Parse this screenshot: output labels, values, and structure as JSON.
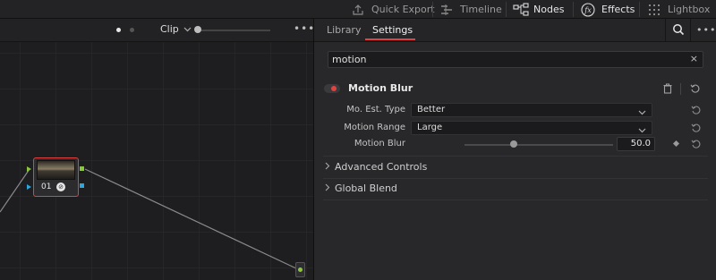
{
  "toolbar": {
    "items": [
      {
        "label": "Quick Export",
        "icon": "upload-icon"
      },
      {
        "label": "Timeline",
        "icon": "timeline-icon"
      },
      {
        "label": "Nodes",
        "icon": "nodes-icon"
      },
      {
        "label": "Effects",
        "icon": "fx-icon"
      },
      {
        "label": "Lightbox",
        "icon": "grid-icon"
      }
    ]
  },
  "node_editor": {
    "mode_label": "Clip",
    "node_label": "01"
  },
  "inspector": {
    "tabs": [
      {
        "label": "Library"
      },
      {
        "label": "Settings"
      }
    ],
    "active_tab": "Settings",
    "search": {
      "value": "motion",
      "clear_glyph": "×"
    },
    "effect": {
      "name": "Motion Blur",
      "enabled_color": "#e04242",
      "params": {
        "est_type": {
          "label": "Mo. Est. Type",
          "value": "Better"
        },
        "range": {
          "label": "Motion Range",
          "value": "Large"
        },
        "blur": {
          "label": "Motion Blur",
          "value": "50.0"
        }
      }
    },
    "sections": [
      {
        "label": "Advanced Controls"
      },
      {
        "label": "Global Blend"
      }
    ]
  },
  "colors": {
    "accent": "#e04242",
    "node_border": "#e04242",
    "input_green": "#8cc63e",
    "port_blue": "#2aa6e0"
  }
}
